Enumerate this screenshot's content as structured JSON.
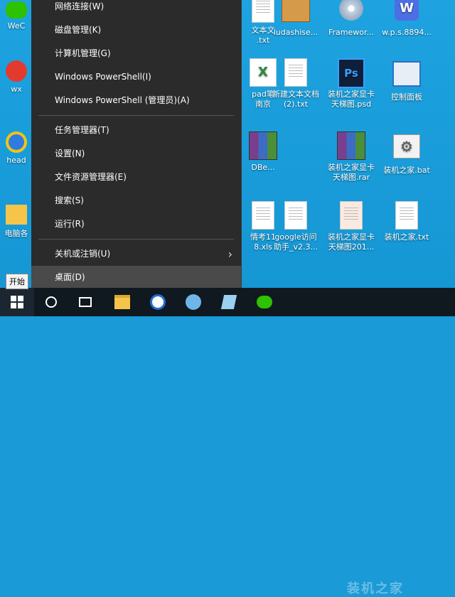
{
  "desktop": {
    "left_icons": [
      {
        "label": "WeC",
        "icon": "wechat-icon"
      },
      {
        "label": "wx",
        "icon": "mascot-icon"
      },
      {
        "label": "head",
        "icon": "ie-icon"
      },
      {
        "label": "电脑各",
        "icon": "folder-icon"
      }
    ],
    "icons": [
      {
        "label": "文本文\n.txt",
        "icon": "text-document-icon"
      },
      {
        "label": "ludashise...",
        "icon": "package-icon"
      },
      {
        "label": "Framewor...",
        "icon": "disc-installer-icon"
      },
      {
        "label": "w.p.s.8894...",
        "icon": "wps-icon"
      },
      {
        "label": "pad笔\n南京",
        "icon": "spreadsheet-icon"
      },
      {
        "label": "新建文本文档\n(2).txt",
        "icon": "text-document-icon"
      },
      {
        "label": "装机之家显卡\n天梯图.psd",
        "icon": "photoshop-icon"
      },
      {
        "label": "控制面板",
        "icon": "control-panel-icon"
      },
      {
        "label": "DBe...",
        "icon": "rar-archive-icon"
      },
      {
        "label": "装机之家显卡\n天梯图.rar",
        "icon": "rar-archive-icon"
      },
      {
        "label": "装机之家.bat",
        "icon": "batch-file-icon"
      },
      {
        "label": "情考11\n8.xls",
        "icon": "spreadsheet-icon"
      },
      {
        "label": "google访问\n助手_v2.3...",
        "icon": "text-document-icon"
      },
      {
        "label": "装机之家显卡\n天梯图201...",
        "icon": "image-icon"
      },
      {
        "label": "装机之家.txt",
        "icon": "text-document-icon"
      }
    ]
  },
  "menu": {
    "items": [
      {
        "label": "网络连接(W)",
        "highlight": false
      },
      {
        "label": "磁盘管理(K)",
        "highlight": false
      },
      {
        "label": "计算机管理(G)",
        "highlight": false
      },
      {
        "label": "Windows PowerShell(I)",
        "highlight": false
      },
      {
        "label": "Windows PowerShell (管理员)(A)",
        "highlight": false
      },
      {
        "label": "任务管理器(T)",
        "highlight": false
      },
      {
        "label": "设置(N)",
        "highlight": false
      },
      {
        "label": "文件资源管理器(E)",
        "highlight": false
      },
      {
        "label": "搜索(S)",
        "highlight": false
      },
      {
        "label": "运行(R)",
        "highlight": false
      },
      {
        "label": "关机或注销(U)",
        "highlight": false,
        "submenu": true
      },
      {
        "label": "桌面(D)",
        "highlight": true
      }
    ],
    "submenu_glyph": "›"
  },
  "taskbar": {
    "start_tooltip": "开始",
    "start_icon": "windows-logo-icon",
    "pinned": [
      "cortana-search-icon",
      "task-view-icon",
      "file-explorer-icon",
      "sogou-icon",
      "browser-icon",
      "notes-icon",
      "wechat-icon"
    ]
  },
  "watermark": "装机之家",
  "colors": {
    "desktop": "#1a9ad6",
    "menu_bg": "#2b2b2b",
    "highlight": "#4a4a4a",
    "taskbar": "#101820"
  }
}
